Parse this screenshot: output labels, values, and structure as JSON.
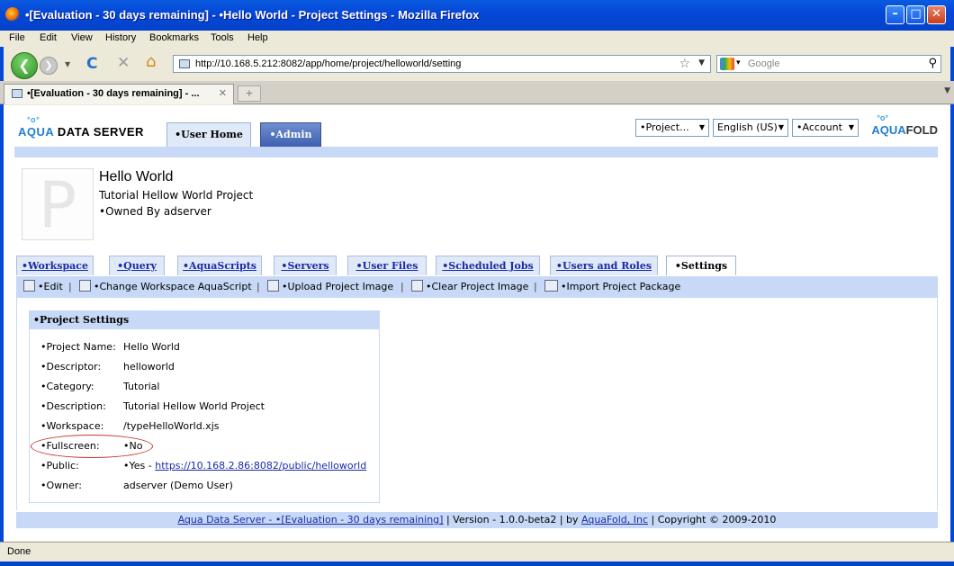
{
  "window": {
    "title": "•[Evaluation - 30 days remaining] - •Hello World - Project Settings - Mozilla Firefox",
    "min_glyph": "–",
    "max_glyph": "□",
    "close_glyph": "✕"
  },
  "menu": [
    "File",
    "Edit",
    "View",
    "History",
    "Bookmarks",
    "Tools",
    "Help"
  ],
  "nav": {
    "back_glyph": "❮",
    "forward_glyph": "❯",
    "reload_glyph": "C",
    "stop_glyph": "✕",
    "home_glyph": "⌂",
    "url": "http://10.168.5.212:8082/app/home/project/helloworld/setting",
    "search_placeholder": "Google"
  },
  "tab": {
    "label": "•[Evaluation - 30 days remaining] - ...",
    "new_tab": "+"
  },
  "app": {
    "logo_left": "AQUA",
    "logo_right": " DATA SERVER",
    "user_home_tab": "•User Home",
    "admin_tab": "•Admin",
    "project_select": "•Project...",
    "language_select": "English (US)",
    "account_select": "•Account",
    "brand_aq": "AQUA",
    "brand_fold": "FOLD"
  },
  "project": {
    "image_letter": "P",
    "name": "Hello World",
    "description": "Tutorial Hellow World Project",
    "owned_by": "•Owned By adserver"
  },
  "project_tabs": [
    "•Workspace",
    "•Query",
    "•AquaScripts",
    "•Servers",
    "•User Files",
    "•Scheduled Jobs",
    "•Users and Roles",
    "•Settings"
  ],
  "toolbar": {
    "edit": "•Edit",
    "change_script": "•Change Workspace AquaScript",
    "upload_image": "•Upload Project Image",
    "clear_image": "•Clear Project Image",
    "import_package": "•Import Project Package",
    "sep": "|"
  },
  "settings": {
    "header": "•Project Settings",
    "rows": [
      {
        "label": "•Project Name:",
        "value": "Hello World"
      },
      {
        "label": "•Descriptor:",
        "value": "helloworld"
      },
      {
        "label": "•Category:",
        "value": "Tutorial"
      },
      {
        "label": "•Description:",
        "value": "Tutorial Hellow World Project"
      },
      {
        "label": "•Workspace:",
        "value": "/typeHelloWorld.xjs"
      },
      {
        "label": "•Fullscreen:",
        "value": "•No"
      },
      {
        "label": "•Public:",
        "value": "•Yes - "
      },
      {
        "label": "•Owner:",
        "value": "adserver (Demo User)"
      }
    ],
    "public_link": "https://10.168.2.86:8082/public/helloworld"
  },
  "footer": {
    "link1": "Aqua Data Server - •[Evaluation - 30 days remaining]",
    "version": " | Version - 1.0.0-beta2 | by ",
    "link2": "AquaFold, Inc",
    "copyright": " | Copyright © 2009-2010"
  },
  "status": "Done"
}
